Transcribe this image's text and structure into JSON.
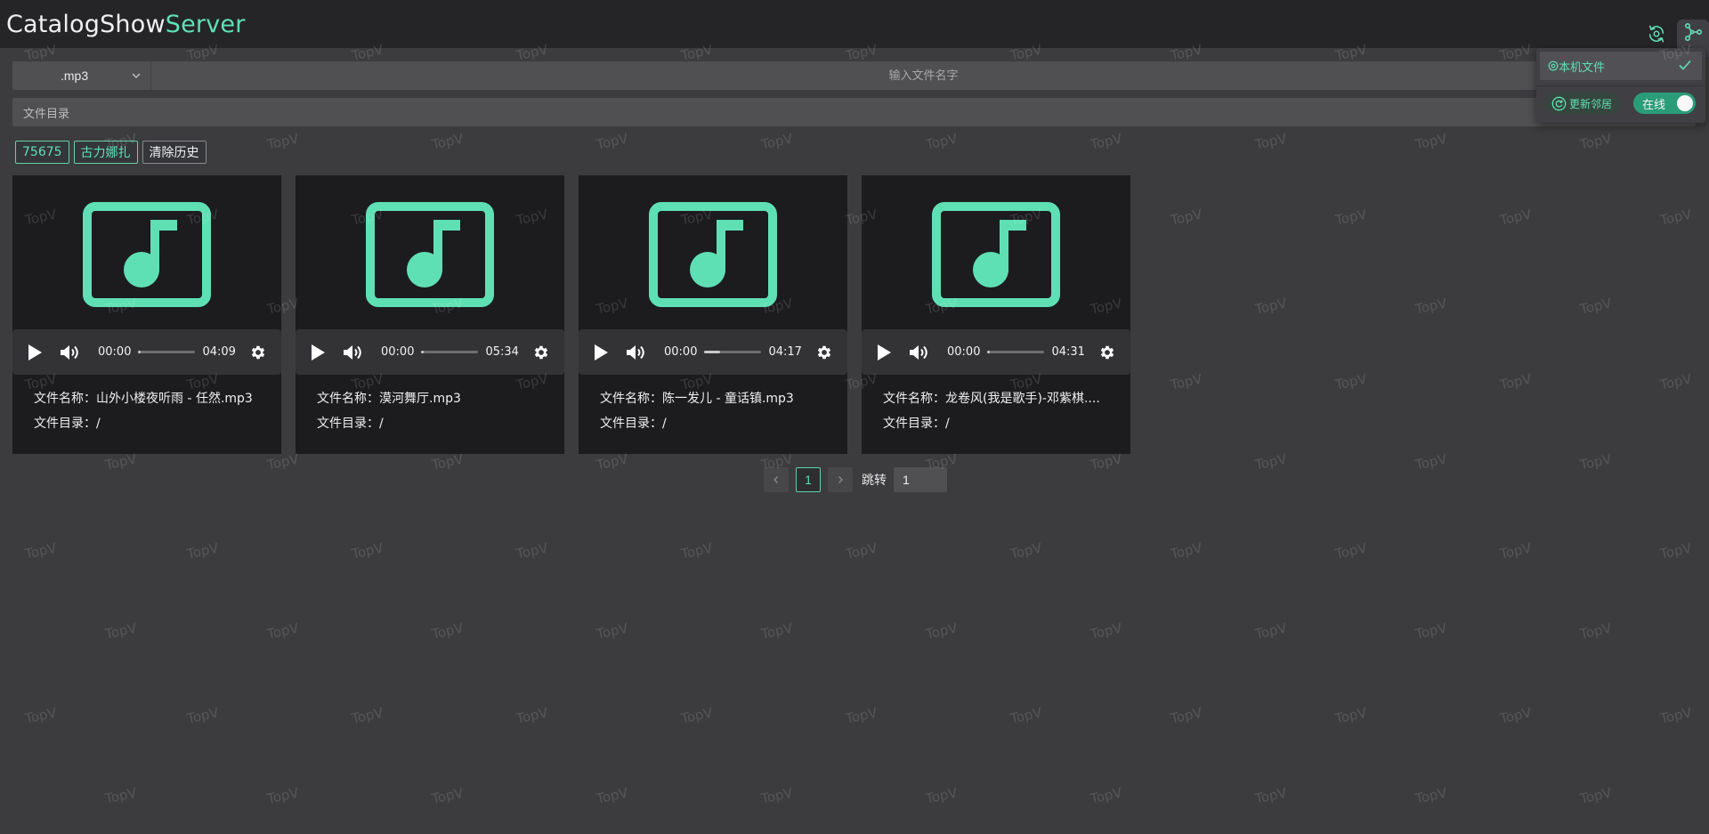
{
  "app": {
    "title_part1": "CatalogShow",
    "title_part2": "Server"
  },
  "header": {
    "icons": [
      "refresh-icon",
      "network-icon"
    ],
    "accent": "#5fe0b4"
  },
  "filter": {
    "extension_selected": ".mp3",
    "search_placeholder": "输入文件名字",
    "directory_placeholder": "文件目录"
  },
  "tags": [
    {
      "label": "75675"
    },
    {
      "label": "古力娜扎"
    },
    {
      "label": "清除历史"
    }
  ],
  "cards": [
    {
      "current_time": "00:00",
      "duration": "04:09",
      "progress": 0.0,
      "name_label": "文件名称：",
      "name": "山外小楼夜听雨 - 任然.mp3",
      "dir_label": "文件目录：",
      "dir": "/"
    },
    {
      "current_time": "00:00",
      "duration": "05:34",
      "progress": 0.0,
      "name_label": "文件名称：",
      "name": "漠河舞厅.mp3",
      "dir_label": "文件目录：",
      "dir": "/"
    },
    {
      "current_time": "00:00",
      "duration": "04:17",
      "progress": 0.28,
      "name_label": "文件名称：",
      "name": "陈一发儿 - 童话镇.mp3",
      "dir_label": "文件目录：",
      "dir": "/"
    },
    {
      "current_time": "00:00",
      "duration": "04:31",
      "progress": 0.0,
      "name_label": "文件名称：",
      "name": "龙卷风(我是歌手)-邓紫棋....",
      "dir_label": "文件目录：",
      "dir": "/"
    }
  ],
  "pagination": {
    "current_page": "1",
    "jump_label": "跳转",
    "jump_value": "1"
  },
  "dropdown": {
    "local_files_label": "本机文件",
    "update_button_label": "更新邻居",
    "online_toggle_label": "在线",
    "online": true
  },
  "watermark_text": "TopV"
}
